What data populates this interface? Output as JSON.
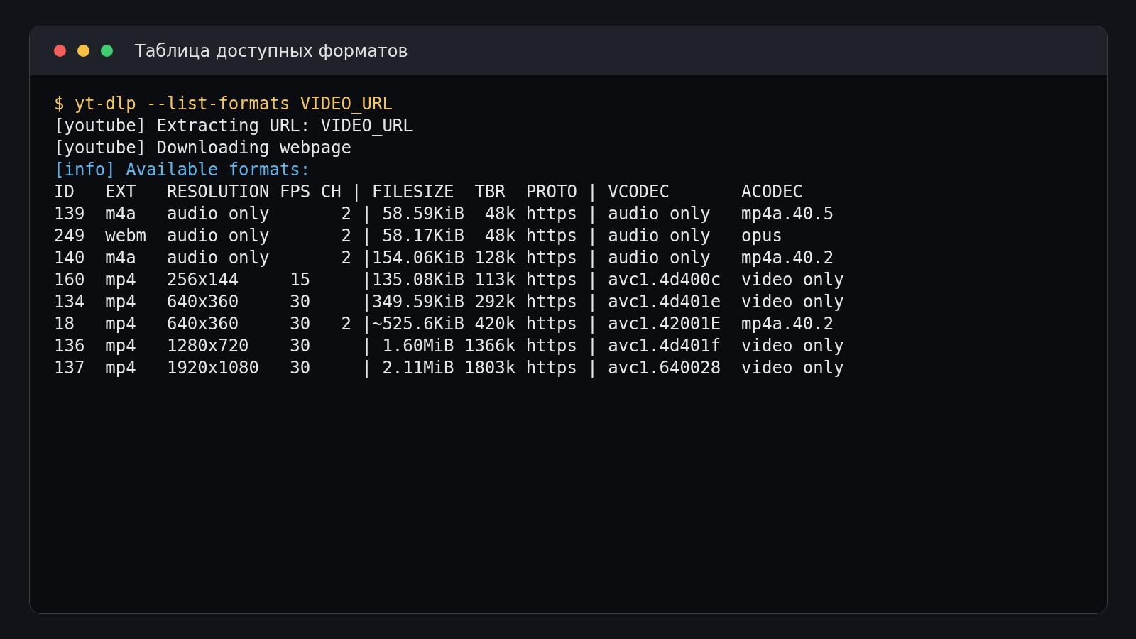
{
  "window": {
    "title": "Таблица доступных форматов"
  },
  "terminal": {
    "lines": [
      {
        "kind": "command",
        "text": "$ yt-dlp --list-formats VIDEO_URL"
      },
      {
        "kind": "output",
        "text": "[youtube] Extracting URL: VIDEO_URL"
      },
      {
        "kind": "output",
        "text": "[youtube] Downloading webpage"
      },
      {
        "kind": "info",
        "text": "[info] Available formats:"
      },
      {
        "kind": "header",
        "text": "ID   EXT   RESOLUTION FPS CH | FILESIZE  TBR  PROTO | VCODEC       ACODEC"
      },
      {
        "kind": "row",
        "text": "139  m4a   audio only       2 | 58.59KiB  48k https | audio only   mp4a.40.5"
      },
      {
        "kind": "row",
        "text": "249  webm  audio only       2 | 58.17KiB  48k https | audio only   opus"
      },
      {
        "kind": "row",
        "text": "140  m4a   audio only       2 |154.06KiB 128k https | audio only   mp4a.40.2"
      },
      {
        "kind": "row",
        "text": "160  mp4   256x144     15     |135.08KiB 113k https | avc1.4d400c  video only"
      },
      {
        "kind": "row",
        "text": "134  mp4   640x360     30     |349.59KiB 292k https | avc1.4d401e  video only"
      },
      {
        "kind": "row",
        "text": "18   mp4   640x360     30   2 |~525.6KiB 420k https | avc1.42001E  mp4a.40.2"
      },
      {
        "kind": "row",
        "text": "136  mp4   1280x720    30     | 1.60MiB 1366k https | avc1.4d401f  video only"
      },
      {
        "kind": "row",
        "text": "137  mp4   1920x1080   30     | 2.11MiB 1803k https | avc1.640028  video only"
      }
    ]
  }
}
